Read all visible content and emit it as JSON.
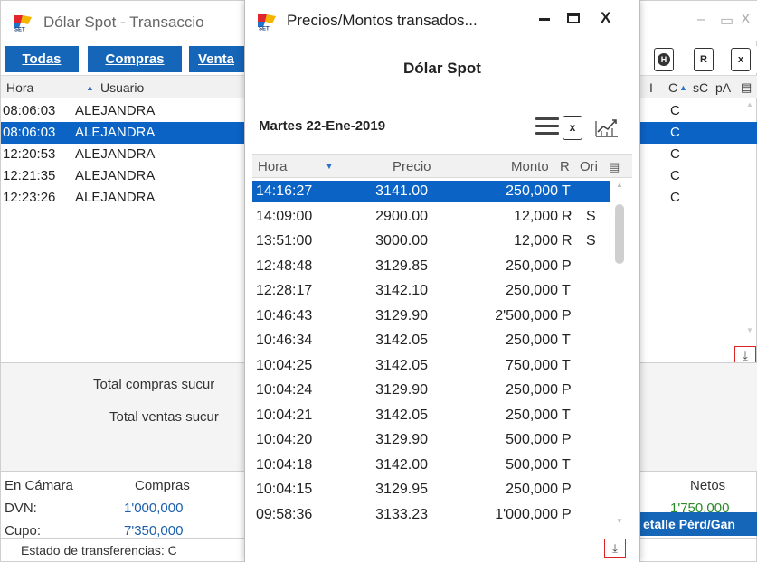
{
  "background_window": {
    "title": "Dólar Spot - Transaccio",
    "controls": {
      "minimize": "–",
      "maximize": "▭",
      "close": "X"
    },
    "tabs": [
      "Todas",
      "Compras",
      "Venta"
    ],
    "toolbar_icons": [
      "H",
      "R",
      "x"
    ],
    "columns": {
      "hora": "Hora",
      "usuario": "Usuario",
      "i": "I",
      "c": "C",
      "sc": "sC",
      "pa": "pA"
    },
    "rows": [
      {
        "hora": "08:06:03",
        "usuario": "ALEJANDRA",
        "c": "C",
        "selected": false
      },
      {
        "hora": "08:06:03",
        "usuario": "ALEJANDRA",
        "c": "C",
        "selected": true
      },
      {
        "hora": "12:20:53",
        "usuario": "ALEJANDRA",
        "c": "C",
        "selected": false
      },
      {
        "hora": "12:21:35",
        "usuario": "ALEJANDRA",
        "c": "C",
        "selected": false
      },
      {
        "hora": "12:23:26",
        "usuario": "ALEJANDRA",
        "c": "C",
        "selected": false
      }
    ],
    "totals": {
      "compras": "Total compras sucur",
      "ventas": "Total ventas sucur"
    },
    "summary": {
      "en_camara_label": "En Cámara",
      "compras_label": "Compras",
      "netos_label": "Netos",
      "dvn_label": "DVN:",
      "dvn_compras": "1'000,000",
      "dvn_netos": "1'750,000",
      "cupo_label": "Cupo:",
      "cupo_compras": "7'350,000"
    },
    "detalle_button": "etalle Pérd/Gan",
    "estado_text": "Estado de transferencias: C"
  },
  "popup": {
    "title": "Precios/Montos transados...",
    "controls": {
      "close": "X"
    },
    "subtitle": "Dólar Spot",
    "date": "Martes 22-Ene-2019",
    "excel_label": "x",
    "columns": {
      "hora": "Hora",
      "precio": "Precio",
      "monto": "Monto",
      "r": "R",
      "ori": "Ori"
    },
    "rows": [
      {
        "hora": "14:16:27",
        "precio": "3141.00",
        "monto": "250,000",
        "r": "T",
        "ori": "",
        "selected": true
      },
      {
        "hora": "14:09:00",
        "precio": "2900.00",
        "monto": "12,000",
        "r": "R",
        "ori": "S",
        "selected": false
      },
      {
        "hora": "13:51:00",
        "precio": "3000.00",
        "monto": "12,000",
        "r": "R",
        "ori": "S",
        "selected": false
      },
      {
        "hora": "12:48:48",
        "precio": "3129.85",
        "monto": "250,000",
        "r": "P",
        "ori": "",
        "selected": false
      },
      {
        "hora": "12:28:17",
        "precio": "3142.10",
        "monto": "250,000",
        "r": "T",
        "ori": "",
        "selected": false
      },
      {
        "hora": "10:46:43",
        "precio": "3129.90",
        "monto": "2'500,000",
        "r": "P",
        "ori": "",
        "selected": false
      },
      {
        "hora": "10:46:34",
        "precio": "3142.05",
        "monto": "250,000",
        "r": "T",
        "ori": "",
        "selected": false
      },
      {
        "hora": "10:04:25",
        "precio": "3142.05",
        "monto": "750,000",
        "r": "T",
        "ori": "",
        "selected": false
      },
      {
        "hora": "10:04:24",
        "precio": "3129.90",
        "monto": "250,000",
        "r": "P",
        "ori": "",
        "selected": false
      },
      {
        "hora": "10:04:21",
        "precio": "3142.05",
        "monto": "250,000",
        "r": "T",
        "ori": "",
        "selected": false
      },
      {
        "hora": "10:04:20",
        "precio": "3129.90",
        "monto": "500,000",
        "r": "P",
        "ori": "",
        "selected": false
      },
      {
        "hora": "10:04:18",
        "precio": "3142.00",
        "monto": "500,000",
        "r": "T",
        "ori": "",
        "selected": false
      },
      {
        "hora": "10:04:15",
        "precio": "3129.95",
        "monto": "250,000",
        "r": "P",
        "ori": "",
        "selected": false
      },
      {
        "hora": "09:58:36",
        "precio": "3133.23",
        "monto": "1'000,000",
        "r": "P",
        "ori": "",
        "selected": false
      }
    ]
  },
  "colors": {
    "selection": "#0b63c5",
    "tab_blue": "#1565b8",
    "value_blue": "#1b5fae",
    "value_green": "#2a8a2a",
    "highlight_border": "#d22222"
  },
  "icons": {
    "app_logo": "set-fx-logo-icon",
    "menu": "hamburger-menu-icon",
    "excel": "excel-export-icon",
    "chart": "line-chart-icon",
    "download": "download-icon",
    "sort_up": "sort-ascending-icon",
    "sort_down": "sort-descending-icon",
    "column_chooser": "column-chooser-icon"
  }
}
